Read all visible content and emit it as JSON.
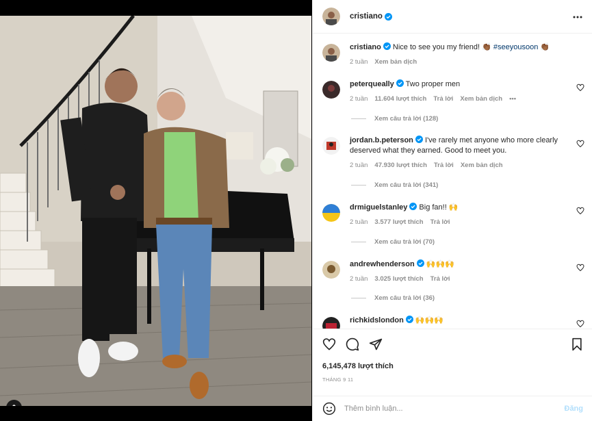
{
  "post": {
    "username": "cristiano",
    "more_icon": "ellipsis-icon",
    "caption_user": "cristiano",
    "caption_text": "Nice to see you my friend! 👏🏾 ",
    "caption_hashtag": "#seeyousoon",
    "caption_emoji": " 👏🏾",
    "caption_time": "2 tuần",
    "caption_translate": "Xem bản dịch"
  },
  "comments": [
    {
      "user": "peterqueally",
      "text": "Two proper men",
      "time": "2 tuần",
      "likes": "11.604 lượt thích",
      "reply": "Trả lời",
      "translate": "Xem bản dịch",
      "more": "•••",
      "view_replies": "Xem câu trả lời (128)",
      "avatar_color": "#3a2a2a"
    },
    {
      "user": "jordan.b.peterson",
      "text": "I've rarely met anyone who more clearly deserved what they earned. Good to meet you.",
      "time": "2 tuần",
      "likes": "47.930 lượt thích",
      "reply": "Trả lời",
      "translate": "Xem bản dịch",
      "view_replies": "Xem câu trả lời (341)",
      "avatar_color": "#c0392b"
    },
    {
      "user": "drmiguelstanley",
      "text": "Big fan!! 🙌",
      "time": "2 tuần",
      "likes": "3.577 lượt thích",
      "reply": "Trả lời",
      "view_replies": "Xem câu trả lời (70)",
      "avatar_color": "#f5c518"
    },
    {
      "user": "andrewhenderson",
      "text": "🙌🙌🙌",
      "time": "2 tuần",
      "likes": "3.025 lượt thích",
      "reply": "Trả lời",
      "view_replies": "Xem câu trả lời (36)",
      "avatar_color": "#7a5a30"
    },
    {
      "user": "richkidslondon",
      "text": "🙌🙌🙌",
      "avatar_color": "#222222"
    }
  ],
  "actions": {
    "like_icon": "heart-icon",
    "comment_icon": "comment-icon",
    "share_icon": "send-icon",
    "save_icon": "bookmark-icon",
    "likes": "6,145,478 lượt thích",
    "date": "THÁNG 9 11"
  },
  "add_comment": {
    "placeholder": "Thêm bình luận...",
    "post_label": "Đăng",
    "emoji_icon": "smiley-icon"
  },
  "colors": {
    "verified": "#0095f6",
    "hashtag": "#00376b",
    "post_disabled": "#b2dffc"
  }
}
